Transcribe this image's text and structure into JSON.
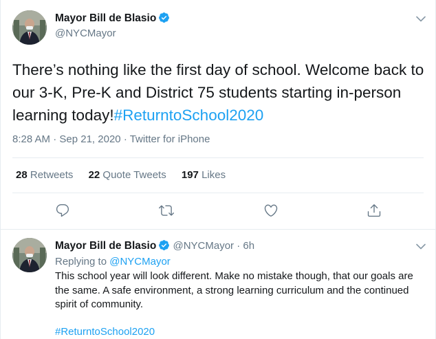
{
  "main_tweet": {
    "display_name": "Mayor Bill de Blasio",
    "handle": "@NYCMayor",
    "text": "There’s nothing like the first day of school. Welcome back to our 3-K, Pre-K and District 75 students starting in-person learning today!",
    "hashtag": "#ReturntoSchool2020",
    "time": "8:28 AM",
    "date": "Sep 21, 2020",
    "source": "Twitter for iPhone",
    "dot": "·",
    "stats": {
      "retweets_count": "28",
      "retweets_label": "Retweets",
      "quotes_count": "22",
      "quotes_label": "Quote Tweets",
      "likes_count": "197",
      "likes_label": "Likes"
    }
  },
  "reply_tweet": {
    "display_name": "Mayor Bill de Blasio",
    "handle": "@NYCMayor",
    "dot": "·",
    "age": "6h",
    "replying_prefix": "Replying to",
    "replying_to": "@NYCMayor",
    "text": "This school year will look different. Make no mistake though, that our goals are the same. A safe environment, a strong learning curriculum and the continued spirit of community.",
    "hashtag": "#ReturntoSchool2020"
  },
  "icons": {
    "verified": "verified-badge-icon",
    "caret": "chevron-down-icon",
    "reply": "reply-icon",
    "retweet": "retweet-icon",
    "like": "heart-icon",
    "share": "share-icon"
  },
  "colors": {
    "accent": "#1da1f2",
    "text": "#14171a",
    "muted": "#657786",
    "border": "#e6ecf0"
  }
}
